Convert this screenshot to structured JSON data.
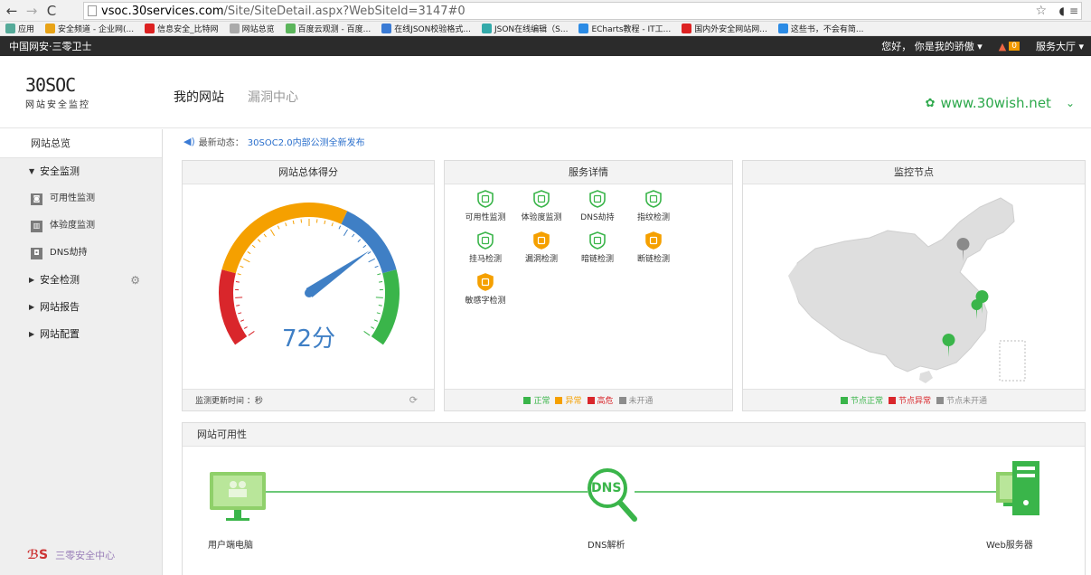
{
  "browser": {
    "url_host": "vsoc.30services.com",
    "url_path": "/Site/SiteDetail.aspx?WebSiteId=3147#0",
    "bookmarks": [
      {
        "label": "应用",
        "color": "#5a9"
      },
      {
        "label": "安全频道 - 企业网(...",
        "color": "#e8a317"
      },
      {
        "label": "信息安全_比特网",
        "color": "#d22"
      },
      {
        "label": "网站总览",
        "color": "#aaa"
      },
      {
        "label": "百度云观测 - 百度...",
        "color": "#5bb55b"
      },
      {
        "label": "在线JSON校验格式...",
        "color": "#3a7bd5"
      },
      {
        "label": "JSON在线编辑（S...",
        "color": "#3aa"
      },
      {
        "label": "ECharts教程 - IT工...",
        "color": "#2b8be5"
      },
      {
        "label": "国内外安全网站网...",
        "color": "#d22"
      },
      {
        "label": "这些书，不会有简...",
        "color": "#2b8be5"
      }
    ]
  },
  "topbar": {
    "brand": "中国网安·三零卫士",
    "greeting": "您好， 你是我的骄傲 ▾",
    "alert_count": "0",
    "service_hall": "服务大厅 ▾"
  },
  "header": {
    "logo_mark": "30SOC",
    "logo_sub": "网站安全监控",
    "tabs": [
      "我的网站",
      "漏洞中心"
    ],
    "site": "www.30wish.net"
  },
  "sidebar": {
    "overview": "网站总览",
    "monitor_group": "安全监测",
    "monitor_items": [
      "可用性监测",
      "体验度监测",
      "DNS劫持"
    ],
    "detect_group": "安全检测",
    "report_group": "网站报告",
    "config_group": "网站配置",
    "footer": "三零安全中心"
  },
  "notice": {
    "prefix": "最新动态：",
    "news": "30SOC2.0内部公测全新发布"
  },
  "score_panel": {
    "title": "网站总体得分",
    "score": "72分",
    "score_value": 72,
    "update_label": "监测更新时间 ：秒"
  },
  "service_panel": {
    "title": "服务详情",
    "items": [
      {
        "label": "可用性监测",
        "status": "normal"
      },
      {
        "label": "体验度监测",
        "status": "normal"
      },
      {
        "label": "DNS劫持",
        "status": "normal"
      },
      {
        "label": "指纹检测",
        "status": "normal"
      },
      {
        "label": "挂马检测",
        "status": "normal"
      },
      {
        "label": "漏洞检测",
        "status": "abnormal"
      },
      {
        "label": "暗链检测",
        "status": "normal"
      },
      {
        "label": "断链检测",
        "status": "abnormal"
      },
      {
        "label": "敏感字检测",
        "status": "abnormal"
      }
    ],
    "legend": [
      {
        "label": "正常",
        "color": "#3ab54a"
      },
      {
        "label": "异常",
        "color": "#f5a000"
      },
      {
        "label": "高危",
        "color": "#d9262b"
      },
      {
        "label": "未开通",
        "color": "#8c8c8c"
      }
    ]
  },
  "nodes_panel": {
    "title": "监控节点",
    "legend": [
      {
        "label": "节点正常",
        "color": "#3ab54a"
      },
      {
        "label": "节点异常",
        "color": "#d9262b"
      },
      {
        "label": "节点未开通",
        "color": "#8c8c8c"
      }
    ]
  },
  "avail_panel": {
    "title": "网站可用性",
    "client_label": "用户端电脑",
    "dns_label": "DNS解析",
    "dns_icon_text": "DNS",
    "server_label": "Web服务器"
  },
  "colors": {
    "green": "#3ab54a",
    "orange": "#f5a000",
    "red": "#d9262b",
    "blue": "#3f7fc5"
  }
}
